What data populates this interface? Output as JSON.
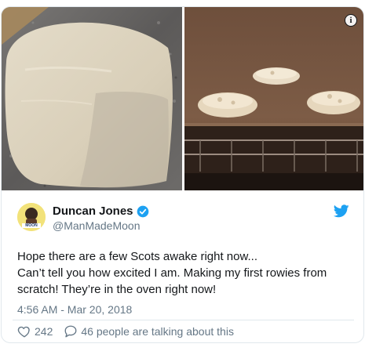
{
  "tweet": {
    "media": {
      "left_image": "rolled dough on a granite counter",
      "right_image": "rowies baking in an oven",
      "info_icon": "info-icon"
    },
    "author": {
      "display_name": "Duncan Jones",
      "handle": "@ManMadeMoon",
      "verified": true,
      "avatar_icon": "avatar",
      "avatar_badge_text": "MOON"
    },
    "brand_icon": "twitter-bird-icon",
    "text": "Hope there are a few Scots awake right now...\nCan’t tell you how excited I am.  Making my first rowies from scratch!  They’re in the oven right now!",
    "timestamp": "4:56 AM - Mar 20, 2018",
    "likes": "242",
    "talking": "46 people are talking about this",
    "colors": {
      "accent": "#1da1f2",
      "text": "#14171a",
      "muted": "#657786",
      "border": "#e1e8ed"
    }
  }
}
